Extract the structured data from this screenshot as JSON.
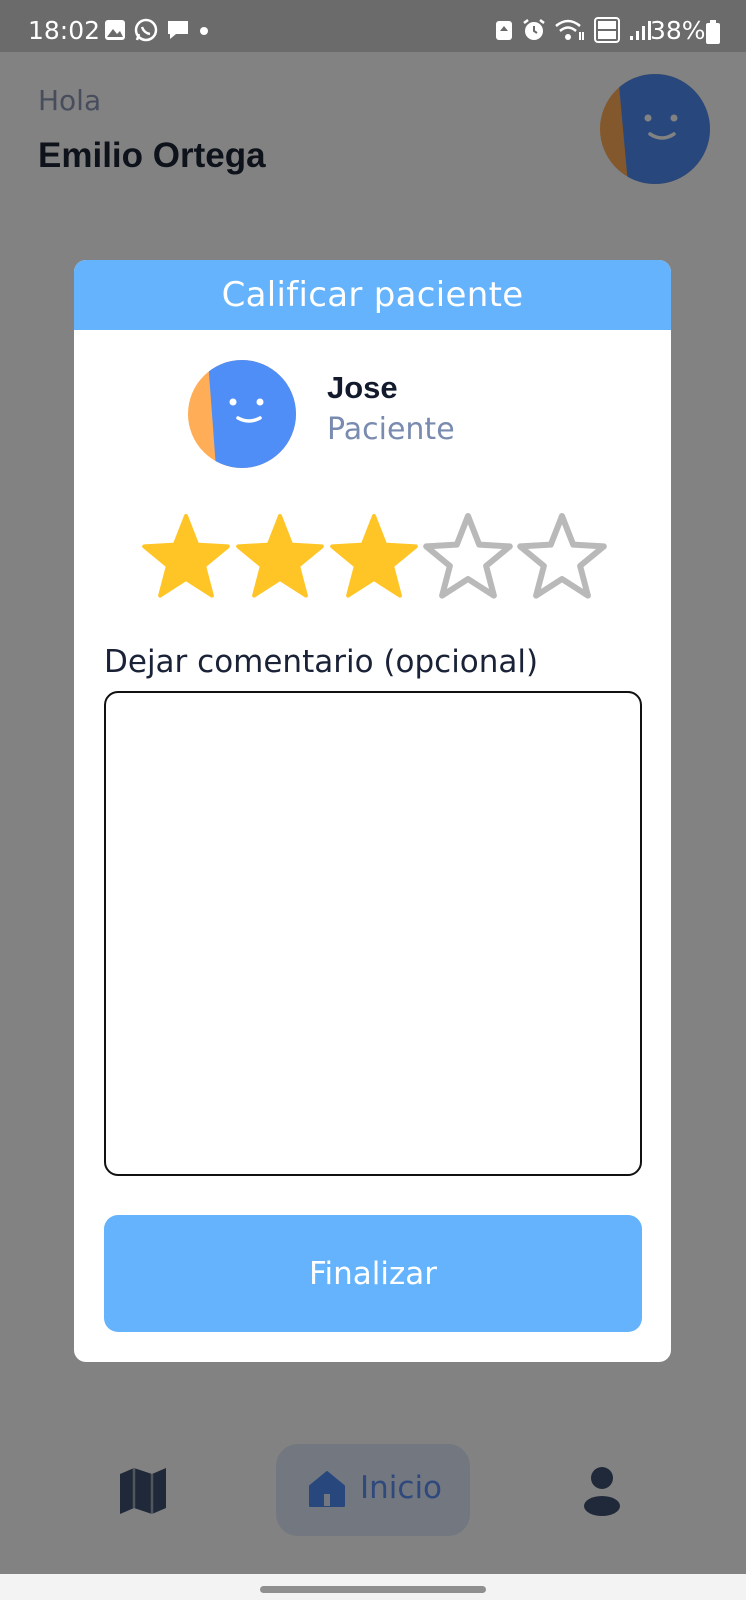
{
  "status_bar": {
    "time": "18:02",
    "battery": "38%",
    "left_icons": [
      "gallery-icon",
      "whatsapp-icon",
      "chat-icon",
      "dot-icon"
    ],
    "right_icons": [
      "recycle-icon",
      "alarm-icon",
      "wifi-icon",
      "volte-icon",
      "signal-icon"
    ]
  },
  "header": {
    "greeting": "Hola",
    "user_name": "Emilio Ortega"
  },
  "modal": {
    "title": "Calificar paciente",
    "patient": {
      "name": "Jose",
      "role": "Paciente"
    },
    "rating": {
      "value": 3,
      "max": 5
    },
    "comment": {
      "label": "Dejar comentario (opcional)",
      "value": "",
      "placeholder": ""
    },
    "submit_label": "Finalizar"
  },
  "bottom_nav": {
    "items": [
      {
        "icon": "map-icon",
        "label": ""
      },
      {
        "icon": "home-icon",
        "label": "Inicio",
        "active": true
      },
      {
        "icon": "person-icon",
        "label": ""
      }
    ]
  },
  "colors": {
    "accent": "#64b3fc",
    "star_filled": "#ffc526",
    "star_empty": "#b9b9b9",
    "scrim": "rgba(0,0,0,0.49)"
  }
}
